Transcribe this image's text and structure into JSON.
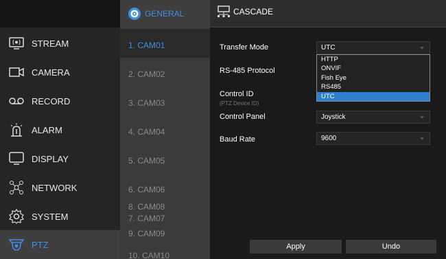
{
  "sidebar": {
    "items": [
      {
        "label": "STREAM",
        "icon": "stream-icon"
      },
      {
        "label": "CAMERA",
        "icon": "camera-icon"
      },
      {
        "label": "RECORD",
        "icon": "record-icon"
      },
      {
        "label": "ALARM",
        "icon": "alarm-icon"
      },
      {
        "label": "DISPLAY",
        "icon": "display-icon"
      },
      {
        "label": "NETWORK",
        "icon": "network-icon"
      },
      {
        "label": "SYSTEM",
        "icon": "gear-icon"
      },
      {
        "label": "PTZ",
        "icon": "ptz-camera-icon",
        "active": true
      }
    ]
  },
  "camlist": {
    "header": "GENERAL",
    "items": [
      "1. CAM01",
      "2. CAM02",
      "3. CAM03",
      "4. CAM04",
      "5. CAM05",
      "6. CAM06",
      "7. CAM07",
      "8. CAM08",
      "9. CAM09",
      "10. CAM10"
    ],
    "active_index": 0
  },
  "main": {
    "tab": "CASCADE",
    "transfer_mode": {
      "label": "Transfer Mode",
      "value": "UTC"
    },
    "rs485": {
      "label": "RS-485 Protocol"
    },
    "control_id": {
      "label": "Control ID",
      "sub": "(PTZ Device ID)"
    },
    "control_panel": {
      "label": "Control Panel",
      "value": "Joystick"
    },
    "baud_rate": {
      "label": "Baud Rate",
      "value": "9600"
    },
    "dropdown": {
      "options": [
        "HTTP",
        "ONVIF",
        "Fish Eye",
        "RS485",
        "UTC"
      ],
      "selected": "UTC"
    },
    "buttons": {
      "apply": "Apply",
      "undo": "Undo"
    }
  },
  "colors": {
    "accent": "#3f8fe0",
    "selection": "#2f7fd0"
  }
}
